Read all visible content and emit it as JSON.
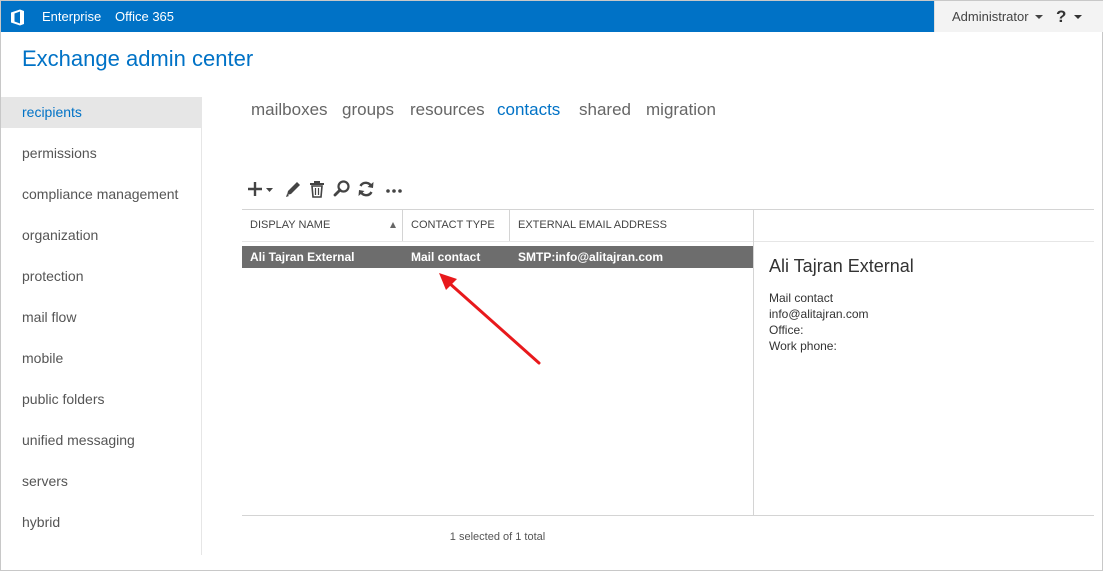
{
  "topbar": {
    "logo_icon": "office-logo-icon",
    "enterprise_label": "Enterprise",
    "office365_label": "Office 365",
    "user_label": "Administrator",
    "help_label": "?",
    "bar_color": "#0072c6"
  },
  "app": {
    "title": "Exchange admin center",
    "accent_color": "#0072c6"
  },
  "leftnav": {
    "items": [
      {
        "label": "recipients",
        "active": true
      },
      {
        "label": "permissions"
      },
      {
        "label": "compliance management"
      },
      {
        "label": "organization"
      },
      {
        "label": "protection"
      },
      {
        "label": "mail flow"
      },
      {
        "label": "mobile"
      },
      {
        "label": "public folders"
      },
      {
        "label": "unified messaging"
      },
      {
        "label": "servers"
      },
      {
        "label": "hybrid"
      }
    ]
  },
  "tabs": [
    {
      "label": "mailboxes"
    },
    {
      "label": "groups"
    },
    {
      "label": "resources"
    },
    {
      "label": "contacts",
      "active": true
    },
    {
      "label": "shared"
    },
    {
      "label": "migration"
    }
  ],
  "toolbar": {
    "icons": [
      "add-icon",
      "edit-icon",
      "delete-icon",
      "search-icon",
      "refresh-icon",
      "more-icon"
    ]
  },
  "list": {
    "columns": [
      "DISPLAY NAME",
      "CONTACT TYPE",
      "EXTERNAL EMAIL ADDRESS"
    ],
    "sort_column": "DISPLAY NAME",
    "rows": [
      {
        "display_name": "Ali Tajran External",
        "contact_type": "Mail contact",
        "email": "SMTP:info@alitajran.com",
        "selected": true
      }
    ],
    "status": "1 selected of 1 total",
    "selected_row_color": "#6d6d6d"
  },
  "details": {
    "title": "Ali Tajran External",
    "type": "Mail contact",
    "email": "info@alitajran.com",
    "office": "Office:",
    "work_phone": "Work phone:"
  },
  "annotation": {
    "arrow_color": "#e8191c"
  }
}
